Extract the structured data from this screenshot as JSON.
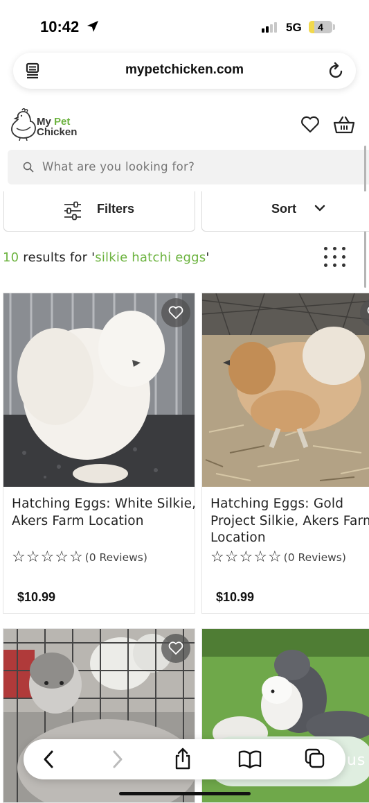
{
  "status": {
    "time": "10:42",
    "network": "5G",
    "battery": "4"
  },
  "browser": {
    "url": "mypetchicken.com"
  },
  "site": {
    "logo_line1_a": "My ",
    "logo_line1_b": "Pet",
    "logo_line2": "Chicken",
    "search_placeholder": "What are you looking for?"
  },
  "controls": {
    "filters_label": "Filters",
    "sort_label": "Sort"
  },
  "results": {
    "count": "10",
    "prefix": " results for '",
    "query": "silkie hatchi eggs",
    "suffix": "'"
  },
  "products": [
    {
      "title": "Hatching Eggs: White Silkie, Akers Farm Location",
      "reviews": "(0 Reviews)",
      "price": "$10.99"
    },
    {
      "title": "Hatching Eggs: Gold Project Silkie, Akers Farm Location",
      "reviews": "(0 Reviews)",
      "price": "$10.99"
    }
  ],
  "stars_glyph": "☆",
  "chat_text": "n us",
  "colors": {
    "brand_green": "#6cb33f",
    "text": "#222222"
  }
}
